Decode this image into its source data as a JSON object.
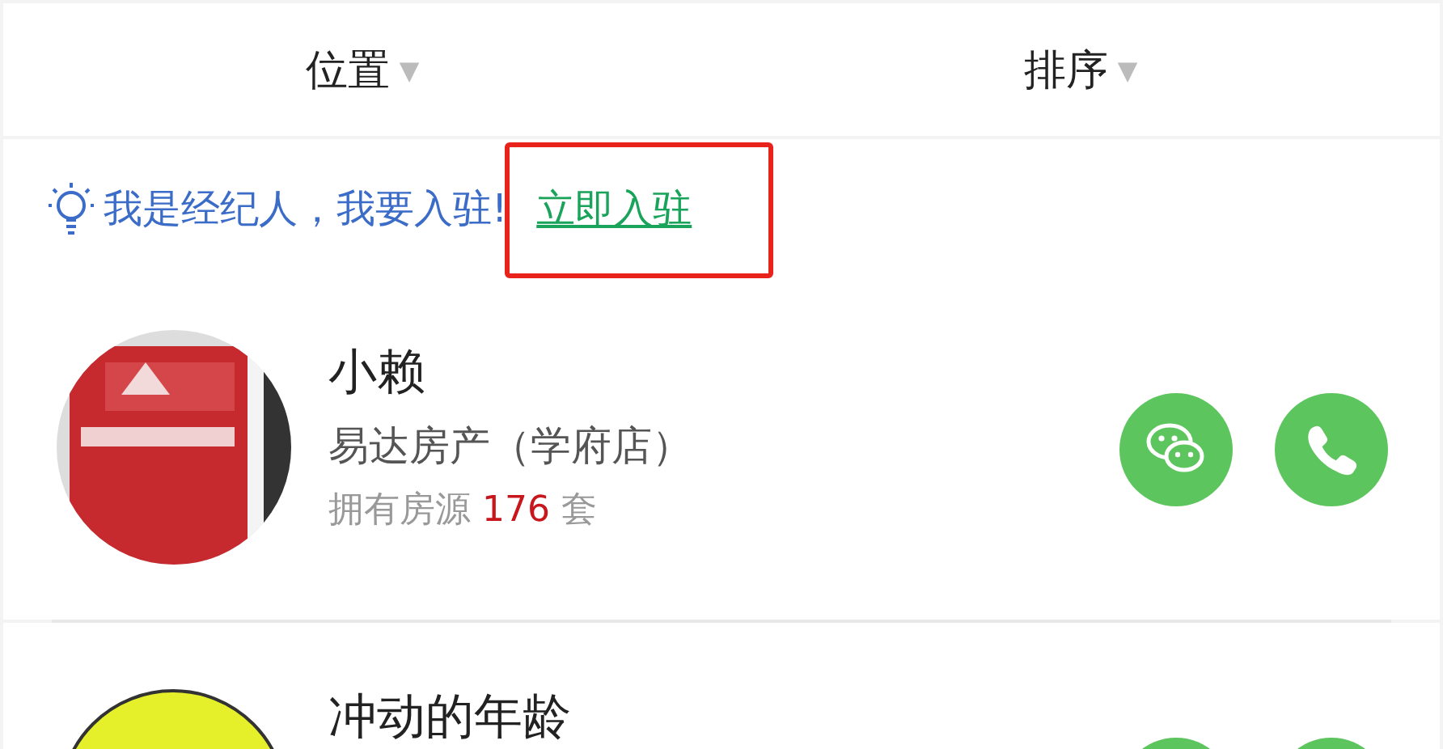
{
  "filters": [
    {
      "label": "位置",
      "caret": "▼"
    },
    {
      "label": "排序",
      "caret": "▼"
    }
  ],
  "tip": {
    "text": "我是经纪人，我要入驻!",
    "link": "立即入驻",
    "highlighted": true
  },
  "agents": [
    {
      "name": "小赖",
      "shop": "易达房产（学府店）",
      "listings_label": "拥有房源",
      "listings_count": "176",
      "listings_unit": "套"
    },
    {
      "name": "冲动的年龄"
    }
  ]
}
